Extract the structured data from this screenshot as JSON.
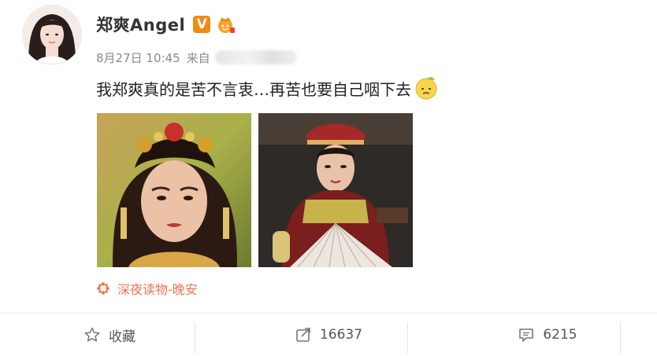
{
  "user": {
    "name": "郑爽Angel",
    "verified_badge": "V",
    "avatar_icon": "avatar-portrait",
    "fan_badge_icon": "fan-crown-icon"
  },
  "meta": {
    "date": "8月27日 10:45",
    "source_label": "来自"
  },
  "post": {
    "text": "我郑爽真的是苦不言衷…再苦也要自己咽下去",
    "emoji_icon": "sad-face-emoji-icon"
  },
  "images": [
    {
      "icon": "photo-portrait-headdress"
    },
    {
      "icon": "photo-portrait-fan"
    }
  ],
  "topic": {
    "label": "深夜读物-晚安",
    "icon": "flower-icon"
  },
  "footer": {
    "favorite_label": "收藏",
    "repost_count": "16637",
    "comment_count": "6215"
  },
  "colors": {
    "topic": "#eb7350",
    "verified": "#f08a13",
    "meta": "#8a8a8a"
  }
}
